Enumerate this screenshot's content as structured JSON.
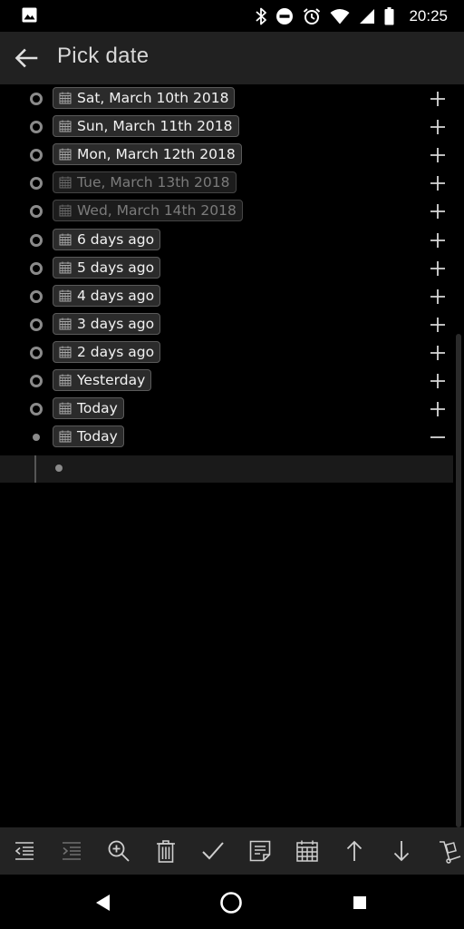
{
  "status_bar": {
    "time": "20:25",
    "icons": [
      "image-icon",
      "bluetooth-icon",
      "do-not-disturb-icon",
      "alarm-icon",
      "wifi-icon",
      "cellular-icon",
      "battery-icon"
    ]
  },
  "app_bar": {
    "title": "Pick date",
    "back_icon": "arrow-left-icon"
  },
  "items": [
    {
      "label": "Sat, March 10th 2018",
      "dimmed": false,
      "action": "expand"
    },
    {
      "label": "Sun, March 11th 2018",
      "dimmed": false,
      "action": "expand"
    },
    {
      "label": "Mon, March 12th 2018",
      "dimmed": false,
      "action": "expand"
    },
    {
      "label": "Tue, March 13th 2018",
      "dimmed": true,
      "action": "expand"
    },
    {
      "label": "Wed, March 14th 2018",
      "dimmed": true,
      "action": "expand"
    },
    {
      "label": "6 days ago",
      "dimmed": false,
      "action": "expand"
    },
    {
      "label": "5 days ago",
      "dimmed": false,
      "action": "expand"
    },
    {
      "label": "4 days ago",
      "dimmed": false,
      "action": "expand"
    },
    {
      "label": "3 days ago",
      "dimmed": false,
      "action": "expand"
    },
    {
      "label": "2 days ago",
      "dimmed": false,
      "action": "expand"
    },
    {
      "label": "Yesterday",
      "dimmed": false,
      "action": "expand"
    },
    {
      "label": "Today",
      "dimmed": false,
      "action": "expand"
    },
    {
      "label": "Today",
      "dimmed": false,
      "action": "collapse"
    }
  ],
  "toolbar": {
    "buttons": [
      "outdent-icon",
      "indent-icon",
      "zoom-in-icon",
      "trash-icon",
      "check-icon",
      "note-icon",
      "calendar-icon",
      "arrow-up-icon",
      "arrow-down-icon",
      "move-icon"
    ]
  },
  "navbar": {
    "buttons": [
      "back-triangle-icon",
      "home-circle-icon",
      "recents-square-icon"
    ]
  },
  "colors": {
    "background": "#000000",
    "app_bar": "#212121",
    "chip_bg": "#2b2b2b",
    "chip_border": "#5a5a5a",
    "dim_text": "#7b7b7b",
    "toolbar": "#232323"
  }
}
